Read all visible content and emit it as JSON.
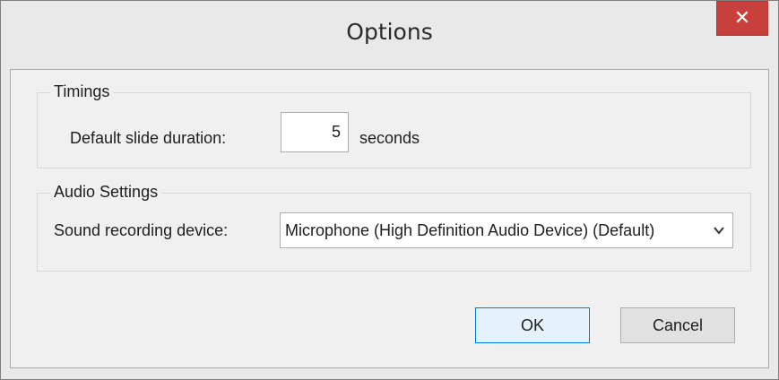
{
  "window": {
    "title": "Options",
    "close_symbol": "✕"
  },
  "timings": {
    "legend": "Timings",
    "duration_label": "Default slide duration:",
    "duration_value": "5",
    "duration_unit": "seconds"
  },
  "audio": {
    "legend": "Audio Settings",
    "device_label": "Sound recording device:",
    "device_selected": "Microphone (High Definition Audio Device) (Default)"
  },
  "buttons": {
    "ok_label": "OK",
    "cancel_label": "Cancel"
  },
  "icons": {
    "close": "close-icon",
    "dropdown": "chevron-down-icon"
  },
  "colors": {
    "close_button": "#c7403b",
    "default_button_border": "#0078d7",
    "default_button_fill": "#e5f1fb"
  }
}
